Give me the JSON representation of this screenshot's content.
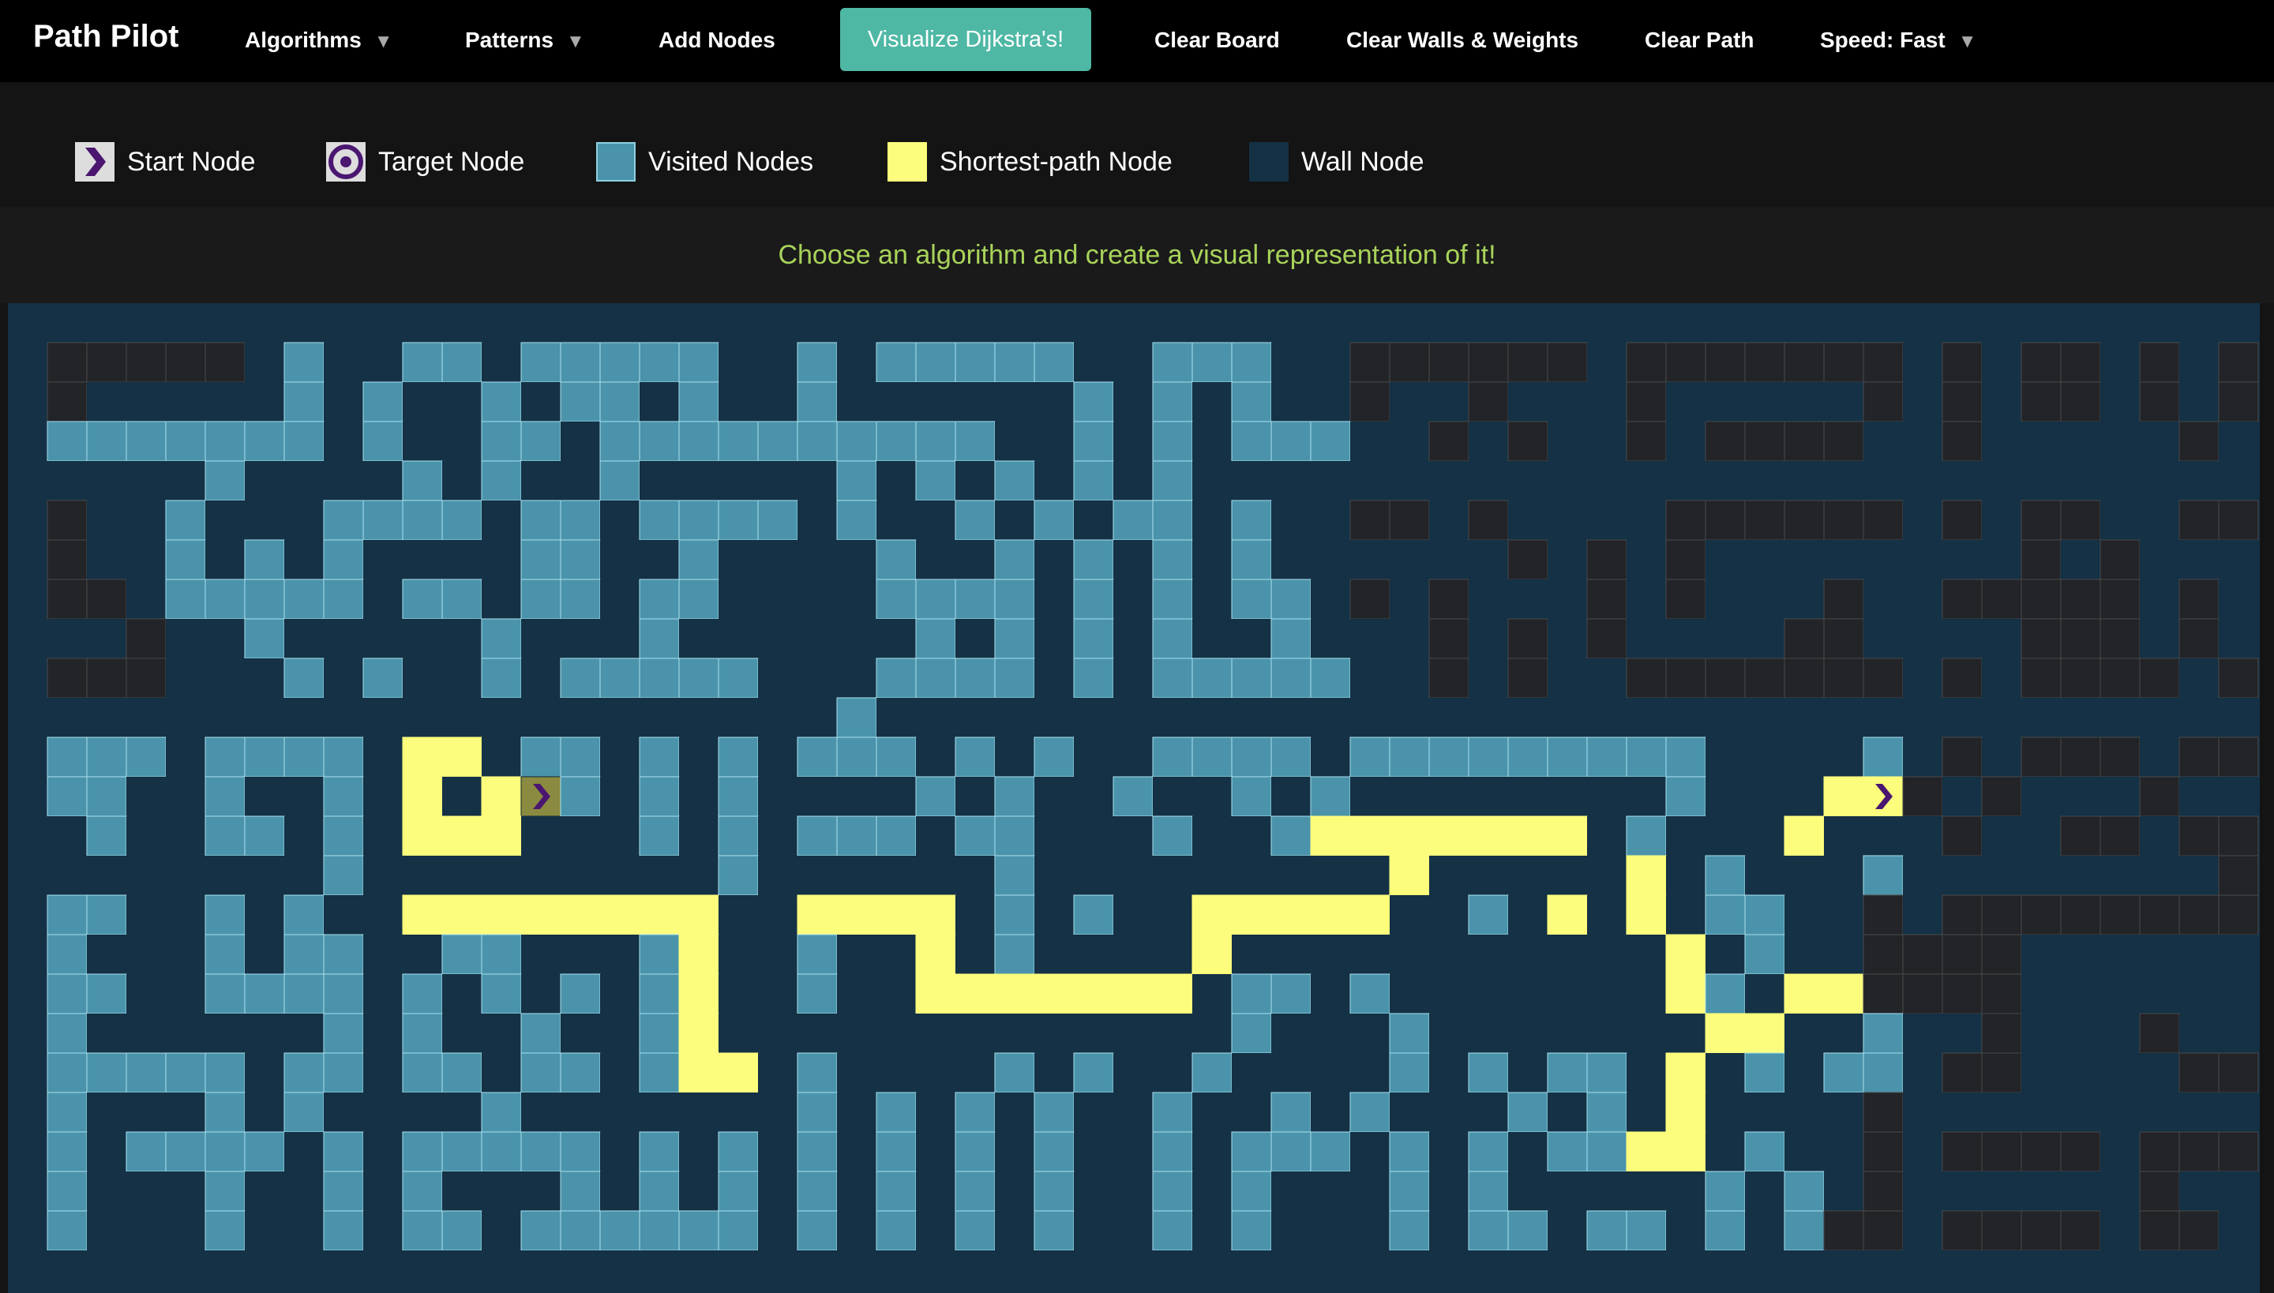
{
  "app": {
    "brand": "Path Pilot",
    "nav": {
      "algorithms": "Algorithms",
      "patterns": "Patterns",
      "add_nodes": "Add Nodes",
      "visualize": "Visualize Dijkstra's!",
      "clear_board": "Clear Board",
      "clear_walls": "Clear Walls & Weights",
      "clear_path": "Clear Path",
      "speed": "Speed: Fast"
    }
  },
  "legend": {
    "start": "Start Node",
    "target": "Target Node",
    "visited": "Visited Nodes",
    "shortest": "Shortest-path Node",
    "wall": "Wall Node"
  },
  "banner": "Choose an algorithm and create a visual representation of it!",
  "colors": {
    "visited": "#4a93ab",
    "shortest": "#fdfd7d",
    "wall": "#143145",
    "unvisited": "#222428",
    "accent": "#4fb8a5",
    "node_icon": "#4a1670"
  },
  "grid": {
    "legend_codes": {
      "0": "unvisited",
      "1": "visited",
      "2": "wall",
      "3": "shortest",
      "S": "start-node",
      "T": "target-node"
    },
    "rows": [
      "2000002122112111112212111112211122000000200000002020020200202",
      "2022222121221211212212222221212122022022202222202020020200202",
      "2111111121221121111111111221212111220202202000022022222022002",
      "2222212222121221222221212121212222222222222222222222222222222",
      "2022122211112112111121221212112122002022220000002020022002002",
      "2022121212222112212222122121212122222202020222222220202220222",
      "2002111112112112112222111121212112020222020222022000002022002",
      "2220221222221222122222212121212212220202022220022220002022002",
      "2000222121221211111222111121211111220202200000002020000202202",
      "2222222222222222222221222222222222222222222222222222222222222",
      "2111211112332112121211121212211112111111111222212020002002202",
      "2112212212323S121212222121221221212222222212223T02022202222202",
      "2212211212333222121211121122212213333333212223222022002002202",
      "2222222212222222221222222122222222232222232122212222222202202",
      "2112212122333333332233332121223333322123232112202000000000002",
      "2122212112211222132212232122223222222222223212200002222222202",
      "2112211112121212132212233333332112122222223123300002222220000",
      "2122222212122122132222222222222122212222222332212202220220202",
      "2111112112112112133212222121221222212121123212112002222002222",
      "2122212122221222222212121212212212122212123222202222222222222",
      "2121111212111112121212121212212111212121133212202000020002222",
      "2122212212122212121212121212212122212122222121202222220220202",
      "2122212212112111111212121212212122212112112121002000020022202",
      "2222222222222222222222222222222222222222222222222222222222222"
    ]
  }
}
